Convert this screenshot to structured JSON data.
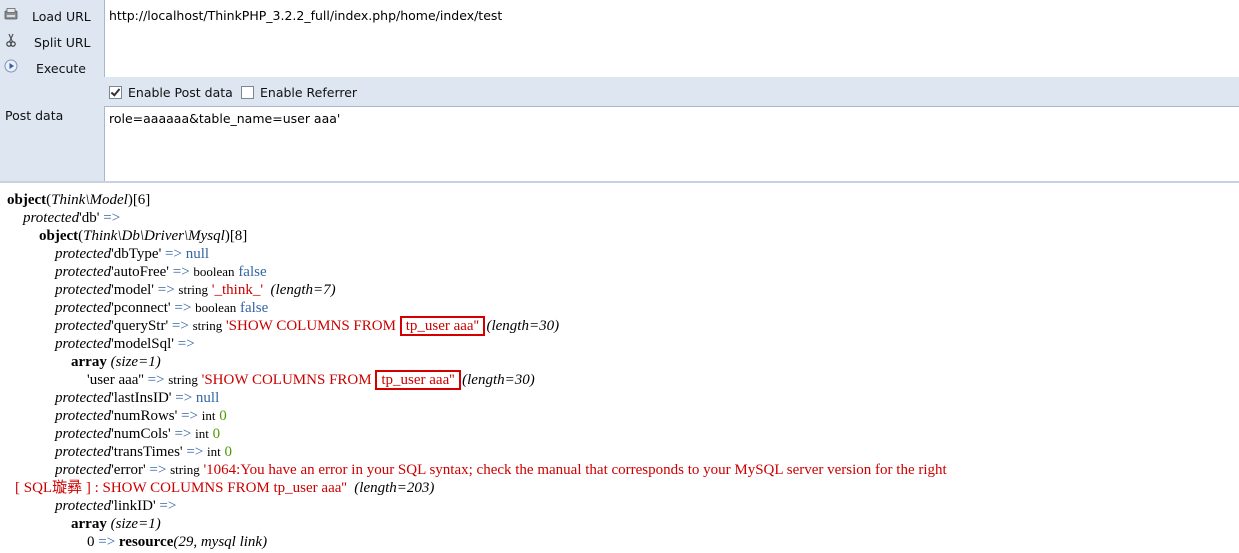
{
  "hackbar": {
    "load_url": "Load URL",
    "split_url": "Split URL",
    "execute": "Execute",
    "url_value": "http://localhost/ThinkPHP_3.2.2_full/index.php/home/index/test",
    "enable_post": "Enable Post data",
    "enable_referrer": "Enable Referrer",
    "enable_post_checked": true,
    "enable_referrer_checked": false,
    "post_label": "Post data",
    "post_value": "role=aaaaaa&table_name=user aaa'"
  },
  "dump": {
    "l0_object": "object",
    "l0_class": "Think\\Model",
    "l0_count": "[6]",
    "protected": "protected",
    "arrow": "=>",
    "l1_key": "'db'",
    "l2_object": "object",
    "l2_class": "Think\\Db\\Driver\\Mysql",
    "l2_count": "[8]",
    "dbType_key": "'dbType'",
    "dbType_val": "null",
    "autoFree_key": "'autoFree'",
    "autoFree_type": "boolean",
    "autoFree_val": "false",
    "model_key": "'model'",
    "model_type": "string",
    "model_val": "'_think_'",
    "model_len": "(length=7)",
    "pconnect_key": "'pconnect'",
    "pconnect_type": "boolean",
    "pconnect_val": "false",
    "queryStr_key": "'queryStr'",
    "queryStr_type": "string",
    "queryStr_val_a": "'SHOW COLUMNS FROM ",
    "queryStr_val_b": "tp_user aaa''",
    "queryStr_len": "(length=30)",
    "modelSql_key": "'modelSql'",
    "array_word": "array",
    "size1": "(size=1)",
    "ms_key": "'user aaa''",
    "ms_type": "string",
    "ms_val_a": "'SHOW COLUMNS FROM ",
    "ms_val_b": "tp_user aaa''",
    "ms_len": "(length=30)",
    "lastInsID_key": "'lastInsID'",
    "lastInsID_val": "null",
    "numRows_key": "'numRows'",
    "numRows_type": "int",
    "numRows_val": "0",
    "numCols_key": "'numCols'",
    "numCols_type": "int",
    "numCols_val": "0",
    "transTimes_key": "'transTimes'",
    "transTimes_type": "int",
    "transTimes_val": "0",
    "error_key": "'error'",
    "error_type": "string",
    "error_val": "'1064:You have an error in your SQL syntax; check the manual that corresponds to your MySQL server version for the right",
    "error_val2": "[ SQL璇彞 ] : SHOW COLUMNS FROM tp_user aaa''",
    "error_len": "(length=203)",
    "linkID_key": "'linkID'",
    "link_idx": "0",
    "resource_word": "resource",
    "resource_val": "(29, mysql link)"
  }
}
